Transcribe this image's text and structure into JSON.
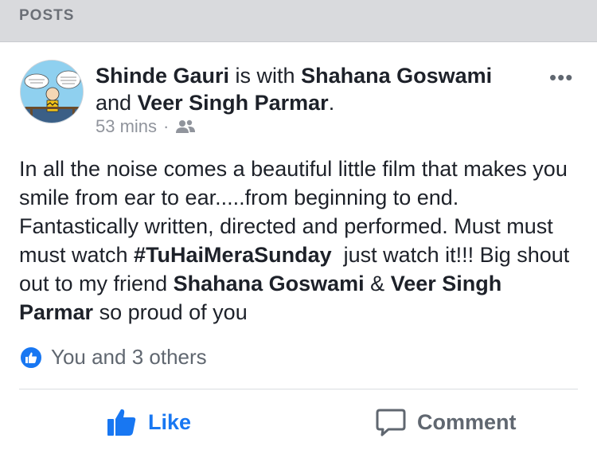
{
  "header": {
    "title": "POSTS"
  },
  "post": {
    "author": "Shinde Gauri",
    "with_text": " is with ",
    "tagged_1": "Shahana Goswami",
    "and_text": " and ",
    "tagged_2": "Veer Singh Parmar",
    "period": ".",
    "time": "53 mins",
    "dot": "·",
    "privacy_icon": "friends-icon",
    "more": "•••",
    "body": {
      "p1": "In all the noise comes a beautiful little film that makes you smile from ear to ear.....from beginning to end. Fantastically written, directed and performed. Must must must watch ",
      "hashtag": "#TuHaiMeraSunday",
      "p2": "  just watch it!!! Big shout out to my friend ",
      "mention_1": "Shahana Goswami",
      "p3": " & ",
      "mention_2": "Veer Singh Parmar",
      "p4": " so proud of you"
    }
  },
  "reactions": {
    "text": "You and 3 others",
    "icon": "like-icon"
  },
  "actions": {
    "like_label": "Like",
    "comment_label": "Comment"
  },
  "colors": {
    "accent": "#1877f2",
    "header_bg": "#d9dadd",
    "muted": "#606770"
  }
}
